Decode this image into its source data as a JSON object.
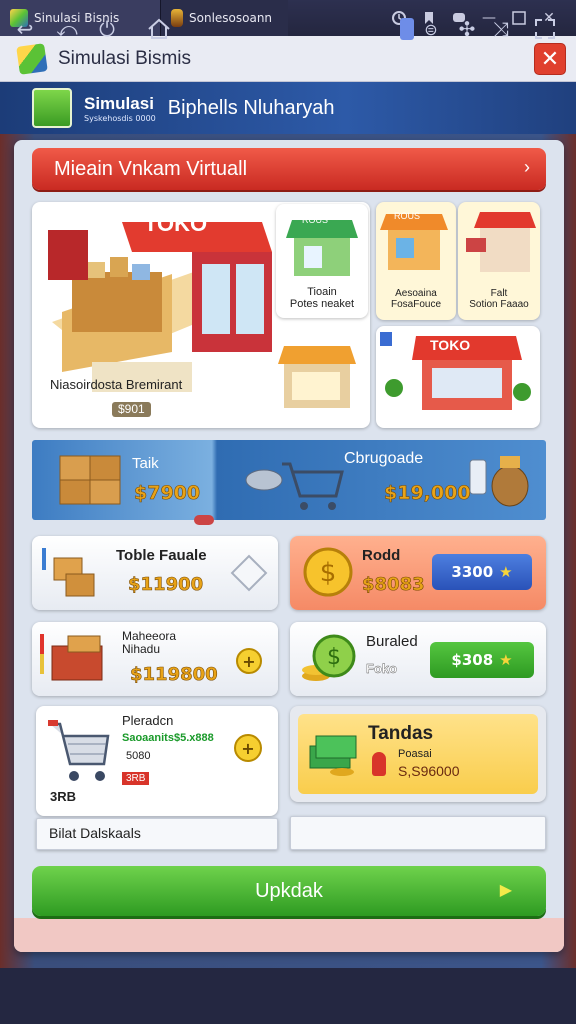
{
  "tabs": [
    {
      "label": "Sinulasi Bisnis"
    },
    {
      "label": "Sonlesosoann"
    }
  ],
  "window": {
    "title": "Simulasi Bismis",
    "close": "✕"
  },
  "app_header": {
    "title": "Simulasi",
    "subtitle": "Syskehosdis 0000",
    "extra": "Biphells Nluharyah"
  },
  "banner": {
    "label": "Mieain Vnkam Virtuall",
    "arrow": "›"
  },
  "hero": {
    "main_caption": "Niasoirdosta Bremirant",
    "main_price": "$901",
    "shop_sign": "TOKO",
    "small1": {
      "sign": "ROUS",
      "label": "Tioain\nPotes neaket"
    },
    "small2": {
      "sign": "ROUS",
      "label": "Aesoaina\nFosaFouce"
    },
    "small3": {
      "label": "Falt\nSotion Faaao"
    },
    "small4": {
      "sign": "TOKO"
    }
  },
  "midband": {
    "left_label": "Taik",
    "left_price": "$7900",
    "right_label": "Cbrugoade",
    "right_price": "$19,000"
  },
  "items": {
    "r1l": {
      "title": "Toble Fauale",
      "price": "$11900"
    },
    "r1r": {
      "title": "Rodd",
      "price": "$8083",
      "btn": "3300"
    },
    "r2l": {
      "title": "Maheeora\nNihadu",
      "price": "$119800"
    },
    "r2r": {
      "title": "Buraled",
      "sub": "Foko",
      "btn": "$308"
    },
    "r3l": {
      "title": "Pleradcn",
      "green": "Saoaanits$5.x888",
      "num": "5080",
      "tag": "3RB",
      "caption": "Bilat Dalskaals"
    },
    "r3r": {
      "title": "Tandas",
      "sub": "Poasai",
      "price": "S,S96000"
    }
  },
  "update_button": {
    "label": "Upkdak",
    "play": "▶"
  },
  "colors": {
    "red": "#d8342a",
    "green": "#3aa92c",
    "blue": "#2f6cb2",
    "gold": "#e8a317"
  }
}
